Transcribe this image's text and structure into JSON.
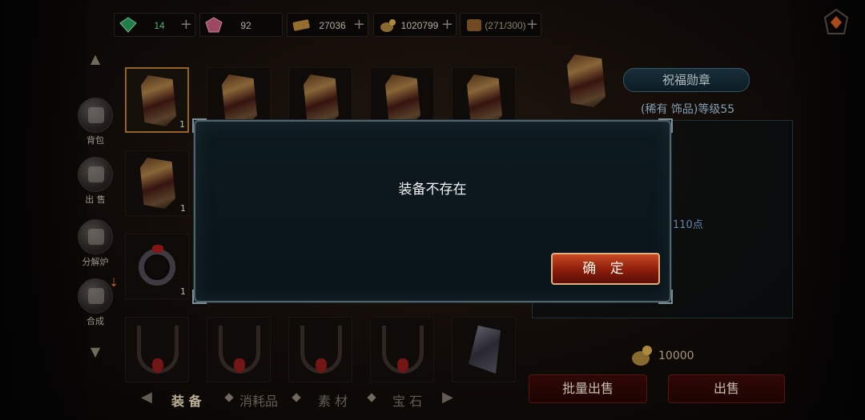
{
  "currency": [
    {
      "icon": "emerald-gem-icon",
      "value": "14",
      "style": "green"
    },
    {
      "icon": "pink-gem-icon",
      "value": "92",
      "style": ""
    },
    {
      "icon": "gold-ticket-icon",
      "value": "27036",
      "style": ""
    },
    {
      "icon": "gold-coin-bag-icon",
      "value": "1020799",
      "style": ""
    },
    {
      "icon": "bag-capacity-icon",
      "value": "(271/300)",
      "style": "dim"
    }
  ],
  "nav": {
    "items": [
      {
        "label": "背包",
        "icon": "backpack-icon"
      },
      {
        "label": "出 售",
        "icon": "sell-bag-icon"
      },
      {
        "label": "分解炉",
        "icon": "furnace-icon"
      },
      {
        "label": "合成",
        "icon": "synthesis-icon"
      }
    ]
  },
  "grid": {
    "row1_counts": [
      "1",
      "",
      "",
      "",
      ""
    ],
    "row2_counts": [
      "1"
    ],
    "row3_counts": [
      "1"
    ]
  },
  "detail": {
    "item_name": "祝福勋章",
    "rarity_line": "(稀有 饰品)等级55",
    "points": "110点",
    "price": "10000"
  },
  "buttons": {
    "batch_sell": "批量出售",
    "sell": "出售"
  },
  "tabs": [
    {
      "label": "装 备",
      "active": true
    },
    {
      "label": "消耗品",
      "active": false
    },
    {
      "label": "素 材",
      "active": false
    },
    {
      "label": "宝 石",
      "active": false
    }
  ],
  "dialog": {
    "message": "装备不存在",
    "confirm": "确 定"
  }
}
